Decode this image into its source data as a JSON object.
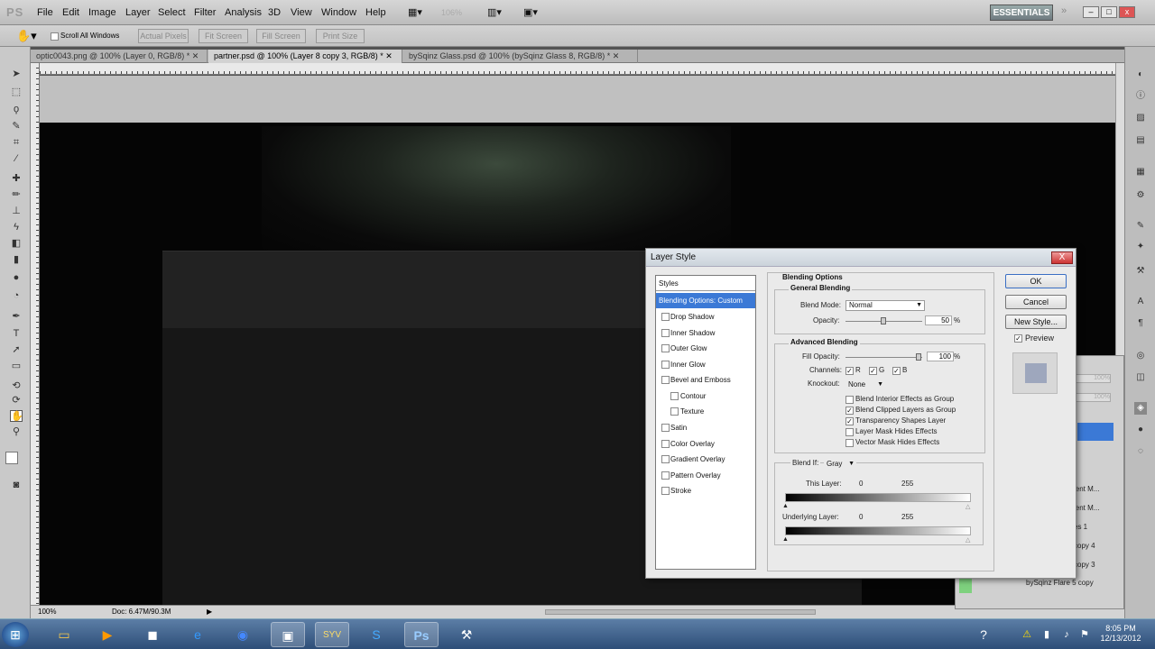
{
  "app": {
    "logo": "PS",
    "zoom_display": "106%",
    "workspace": "ESSENTIALS"
  },
  "menu": [
    "File",
    "Edit",
    "Image",
    "Layer",
    "Select",
    "Filter",
    "Analysis",
    "3D",
    "View",
    "Window",
    "Help"
  ],
  "options": {
    "scroll_all": "Scroll All Windows",
    "actual_pixels": "Actual Pixels",
    "fit_screen": "Fit Screen",
    "fill_screen": "Fill Screen",
    "print_size": "Print Size"
  },
  "tabs": [
    {
      "label": "optic0043.png @ 100% (Layer 0, RGB/8) *"
    },
    {
      "label": "partner.psd @ 100% (Layer 8 copy 3, RGB/8) *"
    },
    {
      "label": "bySqinz Glass.psd @ 100% (bySqinz Glass 8, RGB/8) *"
    }
  ],
  "status": {
    "zoom": "100%",
    "doc": "Doc: 6.47M/90.3M"
  },
  "dialog": {
    "title": "Layer Style",
    "close": "X",
    "styles_header": "Styles",
    "selected": "Blending Options: Custom",
    "items": [
      {
        "label": "Drop Shadow",
        "checked": false
      },
      {
        "label": "Inner Shadow",
        "checked": false
      },
      {
        "label": "Outer Glow",
        "checked": false
      },
      {
        "label": "Inner Glow",
        "checked": false
      },
      {
        "label": "Bevel and Emboss",
        "checked": false
      },
      {
        "label": "Contour",
        "checked": false
      },
      {
        "label": "Texture",
        "checked": false
      },
      {
        "label": "Satin",
        "checked": false
      },
      {
        "label": "Color Overlay",
        "checked": false
      },
      {
        "label": "Gradient Overlay",
        "checked": false
      },
      {
        "label": "Pattern Overlay",
        "checked": false
      },
      {
        "label": "Stroke",
        "checked": false
      }
    ],
    "blending_options": "Blending Options",
    "general": "General Blending",
    "blend_mode_label": "Blend Mode:",
    "blend_mode": "Normal",
    "opacity_label": "Opacity:",
    "opacity": "50",
    "pct": "%",
    "advanced": "Advanced Blending",
    "fill_label": "Fill Opacity:",
    "fill": "100",
    "channels_label": "Channels:",
    "ch_r": "R",
    "ch_g": "G",
    "ch_b": "B",
    "knockout_label": "Knockout:",
    "knockout": "None",
    "opts": [
      {
        "label": "Blend Interior Effects as Group",
        "checked": false
      },
      {
        "label": "Blend Clipped Layers as Group",
        "checked": true
      },
      {
        "label": "Transparency Shapes Layer",
        "checked": true
      },
      {
        "label": "Layer Mask Hides Effects",
        "checked": false
      },
      {
        "label": "Vector Mask Hides Effects",
        "checked": false
      }
    ],
    "blend_if_label": "Blend If:",
    "blend_if": "Gray",
    "this_layer": "This Layer:",
    "underlying": "Underlying Layer:",
    "min": "0",
    "max": "255",
    "ok": "OK",
    "cancel": "Cancel",
    "new_style": "New Style...",
    "preview": "Preview"
  },
  "layers": [
    {
      "label": "ient M..."
    },
    {
      "label": "ient M..."
    },
    {
      "label": "es 1"
    },
    {
      "label": "copy 4"
    },
    {
      "label": "copy 3"
    },
    {
      "label": "bySqinz Flare 5 copy"
    }
  ],
  "layer_pct": [
    "100%",
    "100%"
  ],
  "clock": {
    "time": "8:05 PM",
    "date": "12/13/2012"
  },
  "taskbar": [
    "start",
    "explorer",
    "media-player",
    "video",
    "ie",
    "firefox",
    "app",
    "syv",
    "skype",
    "photoshop",
    "tools"
  ]
}
